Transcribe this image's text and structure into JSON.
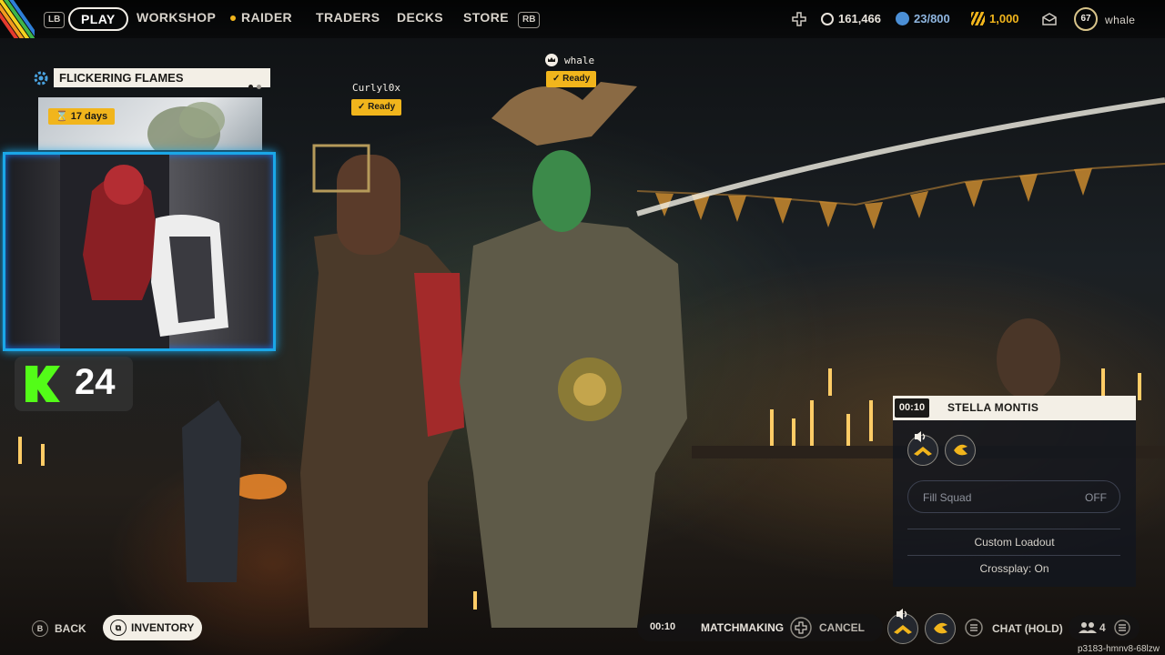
{
  "nav": {
    "lb": "LB",
    "rb": "RB",
    "items": [
      "PLAY",
      "WORKSHOP",
      "RAIDER",
      "TRADERS",
      "DECKS",
      "STORE"
    ]
  },
  "currency": {
    "coins": "161,466",
    "tokens": "23/800",
    "cash": "1,000"
  },
  "profile": {
    "level": "67",
    "name": "whale"
  },
  "event": {
    "title": "FLICKERING FLAMES",
    "days": "17 days"
  },
  "stream": {
    "viewers": "24"
  },
  "players": [
    {
      "name": "Curlyl0x",
      "status": "Ready"
    },
    {
      "name": "whale",
      "status": "Ready"
    }
  ],
  "squad": {
    "time": "00:10",
    "map": "STELLA MONTIS",
    "fill_label": "Fill Squad",
    "fill_value": "OFF",
    "custom_loadout": "Custom Loadout",
    "crossplay": "Crossplay: On"
  },
  "bottom": {
    "back_key": "B",
    "back": "BACK",
    "inventory": "INVENTORY",
    "mm_time": "00:10",
    "matchmaking": "MATCHMAKING",
    "cancel": "CANCEL",
    "chat": "CHAT (HOLD)",
    "party_count": "4",
    "build": "p3183-hmnv8-68lzw"
  },
  "colors": {
    "accent": "#f1b51c",
    "kick": "#53fc18",
    "webcam_border": "#1aa7e8"
  }
}
